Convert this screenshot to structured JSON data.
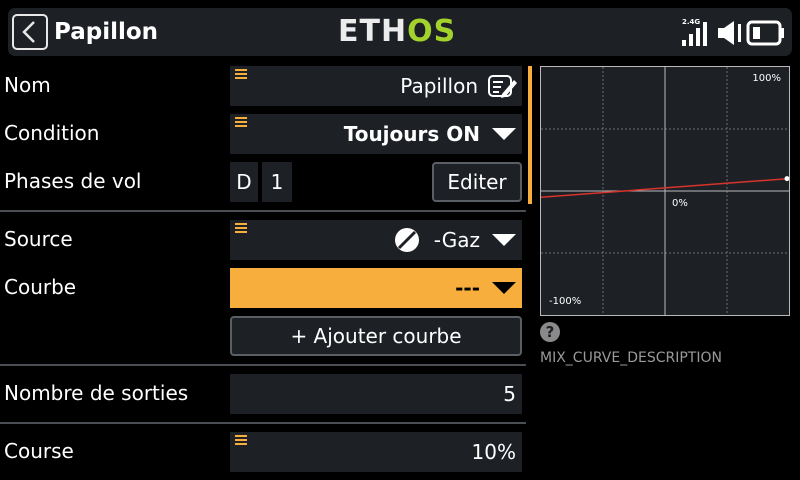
{
  "header": {
    "title": "Papillon",
    "logo_left": "ETH",
    "logo_right": "OS",
    "rf_label": "2.4G"
  },
  "rows": {
    "name": {
      "label": "Nom",
      "value": "Papillon"
    },
    "condition": {
      "label": "Condition",
      "value": "Toujours ON"
    },
    "flight_modes": {
      "label": "Phases de vol",
      "mode_a": "D",
      "mode_b": "1",
      "edit_label": "Editer"
    },
    "source": {
      "label": "Source",
      "value": "-Gaz"
    },
    "curve": {
      "label": "Courbe",
      "value": "---"
    },
    "add_curve": {
      "label": "+ Ajouter courbe"
    },
    "outputs": {
      "label": "Nombre de sorties",
      "value": "5"
    },
    "travel": {
      "label": "Course",
      "value": "10%"
    }
  },
  "graph": {
    "top_label": "100%",
    "mid_label": "0%",
    "bottom_label": "-100%",
    "line_start": -0.05,
    "line_end": 0.1
  },
  "help": {
    "symbol": "?",
    "description": "MIX_CURVE_DESCRIPTION"
  },
  "colors": {
    "accent": "#f7ae3c",
    "field_bg": "#1d2126",
    "curve_line": "#d8332c",
    "logo_green": "#a4d22c"
  }
}
